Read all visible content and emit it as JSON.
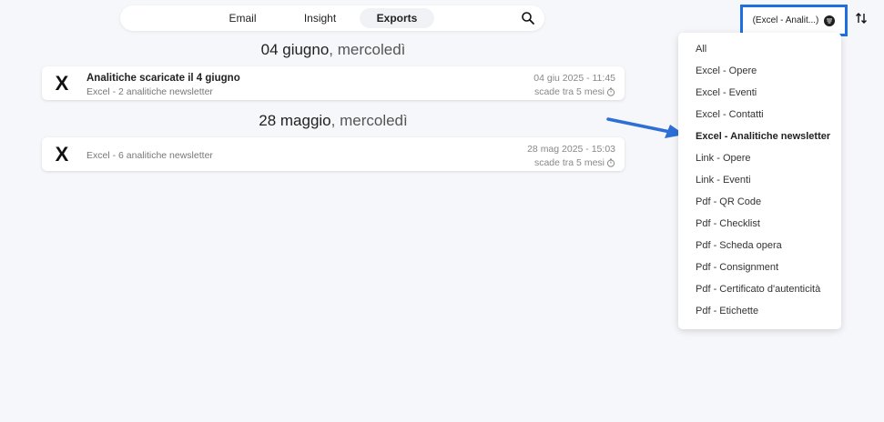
{
  "tabs": [
    {
      "label": "Email"
    },
    {
      "label": "Insight"
    },
    {
      "label": "Exports"
    }
  ],
  "active_tab": "Exports",
  "filter": {
    "label": "(Excel - Analit...)",
    "accent_color": "#1f6fe0"
  },
  "groups": [
    {
      "date": "04 giugno",
      "weekday": ", mercoledì",
      "items": [
        {
          "icon": "X",
          "title": "Analitiche scaricate il 4 giugno",
          "subtitle": "Excel - 2 analitiche newsletter",
          "date": "04 giu 2025 - 11:45",
          "expiry": "scade tra 5 mesi"
        }
      ]
    },
    {
      "date": "28 maggio",
      "weekday": ", mercoledì",
      "items": [
        {
          "icon": "X",
          "title": "",
          "subtitle": "Excel - 6 analitiche newsletter",
          "date": "28 mag 2025 - 15:03",
          "expiry": "scade tra 5 mesi"
        }
      ]
    }
  ],
  "dropdown": {
    "items": [
      "All",
      "Excel - Opere",
      "Excel - Eventi",
      "Excel - Contatti",
      "Excel - Analitiche newsletter",
      "Link - Opere",
      "Link - Eventi",
      "Pdf - QR Code",
      "Pdf - Checklist",
      "Pdf - Scheda opera",
      "Pdf - Consignment",
      "Pdf - Certificato d'autenticità",
      "Pdf - Etichette"
    ],
    "selected": "Excel - Analitiche newsletter"
  },
  "icons": {
    "search": "search-icon",
    "filter": "filter-icon",
    "sort": "sort-icon",
    "timer": "timer-icon",
    "arrow": "pointer-arrow"
  }
}
